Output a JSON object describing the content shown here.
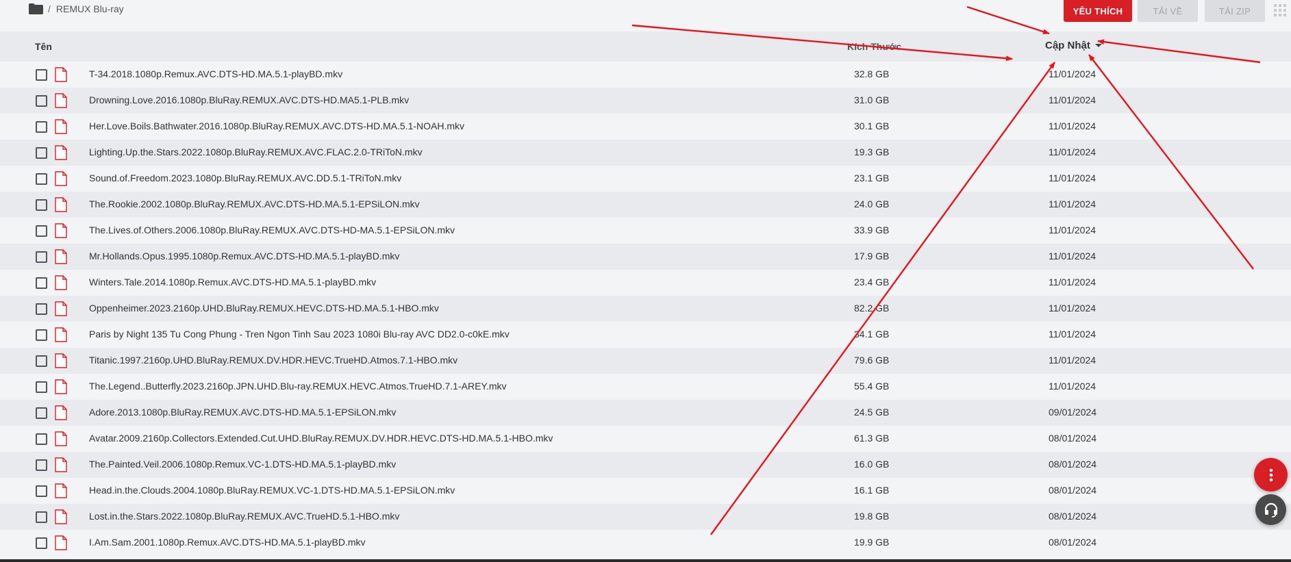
{
  "breadcrumb": {
    "separator": "/",
    "folder_name": "REMUX Blu-ray",
    "icon": "folder-icon"
  },
  "toolbar": {
    "favorite_label": "YÊU THÍCH",
    "download_label": "TẢI VỀ",
    "zip_label": "TẢI ZIP",
    "grid_icon": "grid-icon"
  },
  "table": {
    "columns": {
      "name": "Tên",
      "size": "Kích Thước",
      "updated": "Cập Nhật"
    },
    "sort": {
      "column": "updated",
      "direction": "desc"
    },
    "rows": [
      {
        "name": "T-34.2018.1080p.Remux.AVC.DTS-HD.MA.5.1-playBD.mkv",
        "size": "32.8 GB",
        "date": "11/01/2024"
      },
      {
        "name": "Drowning.Love.2016.1080p.BluRay.REMUX.AVC.DTS-HD.MA5.1-PLB.mkv",
        "size": "31.0 GB",
        "date": "11/01/2024"
      },
      {
        "name": "Her.Love.Boils.Bathwater.2016.1080p.BluRay.REMUX.AVC.DTS-HD.MA.5.1-NOAH.mkv",
        "size": "30.1 GB",
        "date": "11/01/2024"
      },
      {
        "name": "Lighting.Up.the.Stars.2022.1080p.BluRay.REMUX.AVC.FLAC.2.0-TRiToN.mkv",
        "size": "19.3 GB",
        "date": "11/01/2024"
      },
      {
        "name": "Sound.of.Freedom.2023.1080p.BluRay.REMUX.AVC.DD.5.1-TRiToN.mkv",
        "size": "23.1 GB",
        "date": "11/01/2024"
      },
      {
        "name": "The.Rookie.2002.1080p.BluRay.REMUX.AVC.DTS-HD.MA.5.1-EPSiLON.mkv",
        "size": "24.0 GB",
        "date": "11/01/2024"
      },
      {
        "name": "The.Lives.of.Others.2006.1080p.BluRay.REMUX.AVC.DTS-HD-MA.5.1-EPSiLON.mkv",
        "size": "33.9 GB",
        "date": "11/01/2024"
      },
      {
        "name": "Mr.Hollands.Opus.1995.1080p.Remux.AVC.DTS-HD.MA.5.1-playBD.mkv",
        "size": "17.9 GB",
        "date": "11/01/2024"
      },
      {
        "name": "Winters.Tale.2014.1080p.Remux.AVC.DTS-HD.MA.5.1-playBD.mkv",
        "size": "23.4 GB",
        "date": "11/01/2024"
      },
      {
        "name": "Oppenheimer.2023.2160p.UHD.BluRay.REMUX.HEVC.DTS-HD.MA.5.1-HBO.mkv",
        "size": "82.2 GB",
        "date": "11/01/2024"
      },
      {
        "name": "Paris by Night 135 Tu Cong Phung - Tren Ngon Tinh Sau 2023 1080i Blu-ray AVC DD2.0-c0kE.mkv",
        "size": "34.1 GB",
        "date": "11/01/2024"
      },
      {
        "name": "Titanic.1997.2160p.UHD.BluRay.REMUX.DV.HDR.HEVC.TrueHD.Atmos.7.1-HBO.mkv",
        "size": "79.6 GB",
        "date": "11/01/2024"
      },
      {
        "name": "The.Legend..Butterfly.2023.2160p.JPN.UHD.Blu-ray.REMUX.HEVC.Atmos.TrueHD.7.1-AREY.mkv",
        "size": "55.4 GB",
        "date": "11/01/2024"
      },
      {
        "name": "Adore.2013.1080p.BluRay.REMUX.AVC.DTS-HD.MA.5.1-EPSiLON.mkv",
        "size": "24.5 GB",
        "date": "09/01/2024"
      },
      {
        "name": "Avatar.2009.2160p.Collectors.Extended.Cut.UHD.BluRay.REMUX.DV.HDR.HEVC.DTS-HD.MA.5.1-HBO.mkv",
        "size": "61.3 GB",
        "date": "08/01/2024"
      },
      {
        "name": "The.Painted.Veil.2006.1080p.Remux.VC-1.DTS-HD.MA.5.1-playBD.mkv",
        "size": "16.0 GB",
        "date": "08/01/2024"
      },
      {
        "name": "Head.in.the.Clouds.2004.1080p.BluRay.REMUX.VC-1.DTS-HD.MA.5.1-EPSiLON.mkv",
        "size": "16.1 GB",
        "date": "08/01/2024"
      },
      {
        "name": "Lost.in.the.Stars.2022.1080p.BluRay.REMUX.AVC.TrueHD.5.1-HBO.mkv",
        "size": "19.8 GB",
        "date": "08/01/2024"
      },
      {
        "name": "I.Am.Sam.2001.1080p.Remux.AVC.DTS-HD.MA.5.1-playBD.mkv",
        "size": "19.9 GB",
        "date": "08/01/2024"
      }
    ]
  },
  "fab": {
    "more_icon": "more-vertical-icon",
    "support_icon": "headset-icon"
  },
  "colors": {
    "accent": "#d81f26",
    "annotation": "#e8141c",
    "row_alt": "#e9eaed",
    "background": "#f3f4f6"
  }
}
